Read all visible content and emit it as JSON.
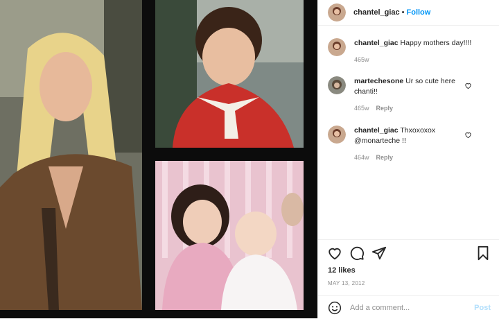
{
  "header": {
    "username": "chantel_giac",
    "separator": "•",
    "follow_label": "Follow"
  },
  "comments": [
    {
      "username": "chantel_giac",
      "text": "Happy mothers day!!!!",
      "time": "465w",
      "reply": ""
    },
    {
      "username": "martecheso​ne",
      "text": "Ur so cute here chanti!!",
      "time": "465w",
      "reply": "Reply"
    },
    {
      "username": "chantel_giac",
      "text": "Thxoxoxox @monarteche !!",
      "time": "464w",
      "reply": "Reply"
    }
  ],
  "actions": {
    "likes": "12 likes",
    "date": "MAY 13, 2012"
  },
  "add_comment": {
    "placeholder": "Add a comment...",
    "post_label": "Post"
  },
  "colors": {
    "link": "#0095f6",
    "post_disabled": "#b2dffc",
    "muted": "#8e8e8e"
  }
}
